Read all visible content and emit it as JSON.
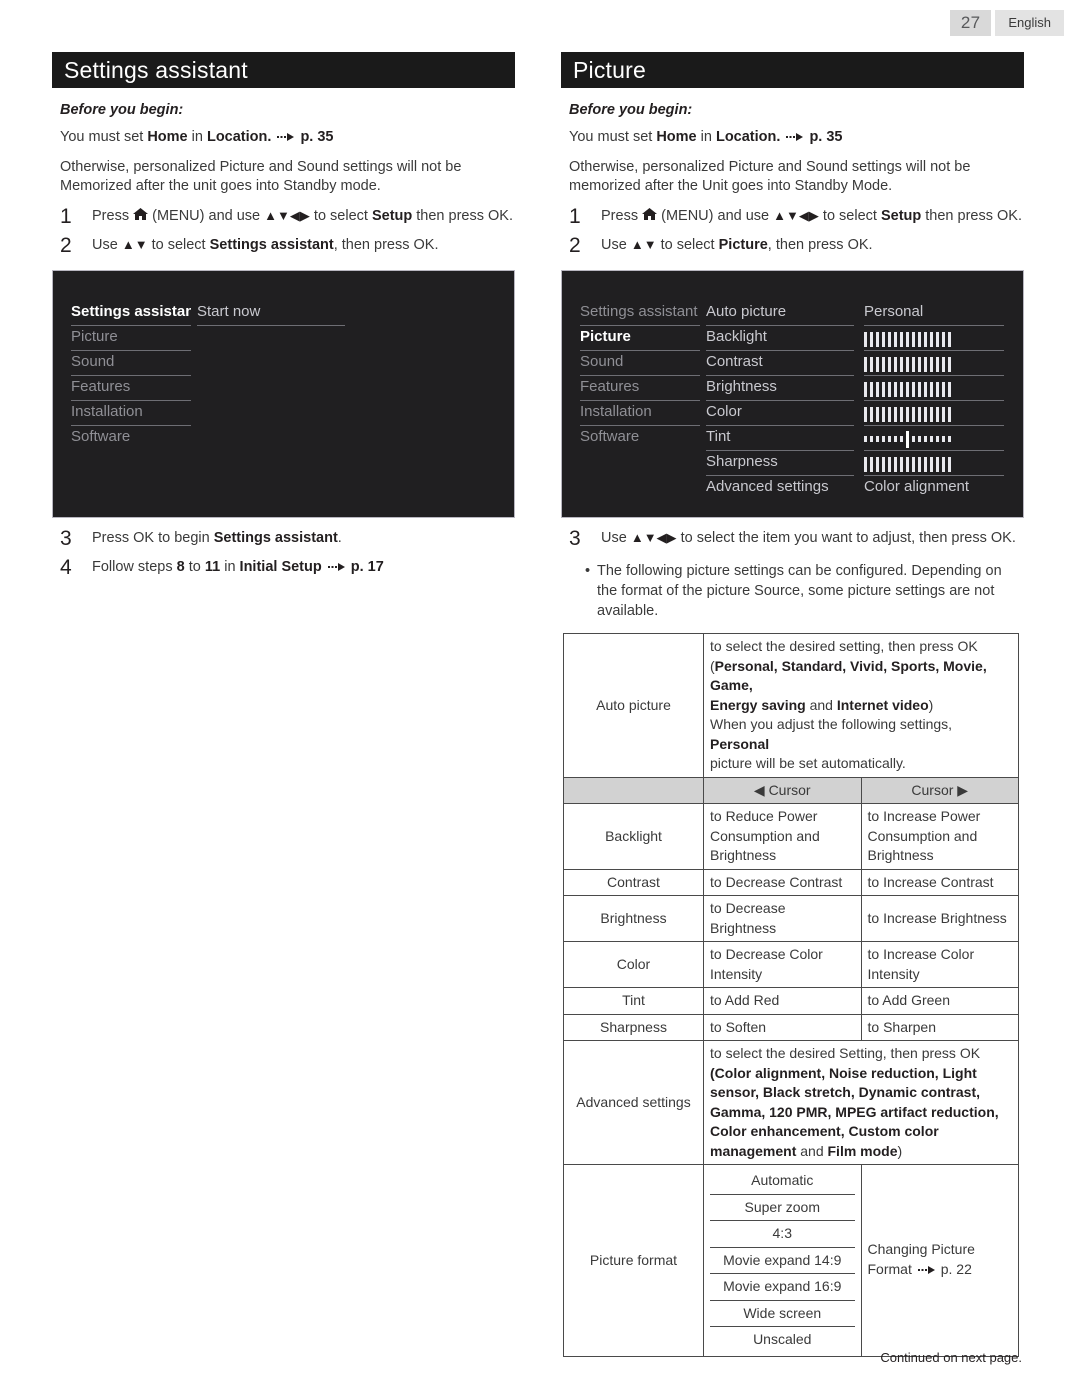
{
  "topbar": {
    "page_number": "27",
    "language": "English"
  },
  "footer": {
    "note": "Continued on next page."
  },
  "left": {
    "header": "Settings assistant",
    "before_label": "Before you begin:",
    "para1_a": "You must set ",
    "para1_home": "Home",
    "para1_b": " in ",
    "para1_location": "Location.",
    "para1_page": "p. 35",
    "para2": "Otherwise, personalized Picture and Sound settings will not be Memorized after the unit goes into Standby mode.",
    "steps": [
      {
        "num": "1",
        "pre": "Press ",
        "menu": "(MENU)",
        "mid": " and use ",
        "arrows": "▲▼◀▶",
        "post": " to select ",
        "bold": "Setup",
        "tail": " then press OK."
      },
      {
        "num": "2",
        "pre": "Use ",
        "arrows": "▲▼",
        "post": " to select ",
        "bold": "Settings assistant",
        "tail": ", then press OK."
      }
    ],
    "osd": {
      "menu": [
        "Settings assistant",
        "Picture",
        "Sound",
        "Features",
        "Installation",
        "Software"
      ],
      "selected_menu": "Settings assistant",
      "items": [
        "Start now"
      ]
    },
    "steps_after": [
      {
        "num": "3",
        "pre": "Press OK to begin ",
        "bold": "Settings assistant",
        "tail": "."
      },
      {
        "num": "4",
        "pre": "Follow steps ",
        "b1": "8",
        "mid": " to ",
        "b2": "11",
        "mid2": " in ",
        "b3": "Initial Setup",
        "page": "p. 17"
      }
    ]
  },
  "right": {
    "header": "Picture",
    "before_label": "Before you begin:",
    "para1_a": "You must set ",
    "para1_home": "Home",
    "para1_b": " in ",
    "para1_location": "Location.",
    "para1_page": "p. 35",
    "para2": "Otherwise, personalized Picture and Sound settings will not be memorized after the Unit goes into Standby Mode.",
    "steps": [
      {
        "num": "1",
        "pre": "Press ",
        "menu": "(MENU)",
        "mid": " and use ",
        "arrows": "▲▼◀▶",
        "post": " to select ",
        "bold": "Setup",
        "tail": " then press OK."
      },
      {
        "num": "2",
        "pre": "Use ",
        "arrows": "▲▼",
        "post": " to select ",
        "bold": "Picture",
        "tail": ", then press OK."
      }
    ],
    "osd": {
      "menu": [
        "Settings assistant",
        "Picture",
        "Sound",
        "Features",
        "Installation",
        "Software"
      ],
      "selected_menu": "Picture",
      "items": [
        "Auto picture",
        "Backlight",
        "Contrast",
        "Brightness",
        "Color",
        "Tint",
        "Sharpness",
        "Advanced settings"
      ],
      "values": {
        "auto_picture": "Personal",
        "advanced_settings": "Color alignment",
        "sliders": [
          "Backlight",
          "Contrast",
          "Brightness",
          "Color",
          "Tint",
          "Sharpness"
        ]
      }
    },
    "step3": {
      "num": "3",
      "pre": "Use ",
      "arrows": "▲▼◀▶",
      "post": " to select the item you want to adjust, then press OK."
    },
    "bullet": "The following picture settings can be configured. Depending on the format of the picture Source, some picture settings are not available.",
    "table": {
      "auto_picture": {
        "label": "Auto picture",
        "line1": "to select the desired setting, then press OK",
        "line2_open": "(",
        "line2_opts": "Personal, Standard, Vivid, Sports, Movie, Game,",
        "line3_opts_a": "Energy saving",
        "line3_and": " and ",
        "line3_opts_b": "Internet video",
        "line3_close": ")",
        "line4_a": "When you adjust the following settings, ",
        "line4_b": "Personal",
        "line5": "picture will be set automatically."
      },
      "cursor_left": "◀ Cursor",
      "cursor_right": "Cursor ▶",
      "rows": [
        {
          "label": "Backlight",
          "left": "to Reduce Power Consumption and Brightness",
          "right": "to Increase Power Consumption and Brightness"
        },
        {
          "label": "Contrast",
          "left": "to Decrease Contrast",
          "right": "to Increase Contrast"
        },
        {
          "label": "Brightness",
          "left": "to Decrease Brightness",
          "right": "to Increase Brightness"
        },
        {
          "label": "Color",
          "left": "to Decrease Color Intensity",
          "right": "to Increase Color Intensity"
        },
        {
          "label": "Tint",
          "left": "to Add Red",
          "right": "to Add Green"
        },
        {
          "label": "Sharpness",
          "left": "to Soften",
          "right": "to Sharpen"
        }
      ],
      "advanced": {
        "label": "Advanced settings",
        "line1": "to select the desired Setting, then press OK",
        "line2": "(Color alignment, Noise reduction, Light",
        "line3": "sensor, Black stretch, Dynamic contrast,",
        "line4": "Gamma, 120 PMR, MPEG artifact reduction,",
        "line5": "Color enhancement, Custom color",
        "line6_a": "management",
        "line6_and": " and ",
        "line6_b": "Film mode",
        "line6_close": ")"
      },
      "picture_format": {
        "label": "Picture format",
        "options": [
          "Automatic",
          "Super zoom",
          "4:3",
          "Movie expand 14:9",
          "Movie expand 16:9",
          "Wide screen",
          "Unscaled"
        ],
        "note_a": "Changing Picture",
        "note_b": "Format",
        "note_page": "p. 22"
      }
    }
  },
  "colors": {
    "header_bg": "#1a1a1a",
    "osd_bg": "#201f21",
    "table_border": "#4a4a4a",
    "cursor_head_bg": "#d2d2d2"
  }
}
